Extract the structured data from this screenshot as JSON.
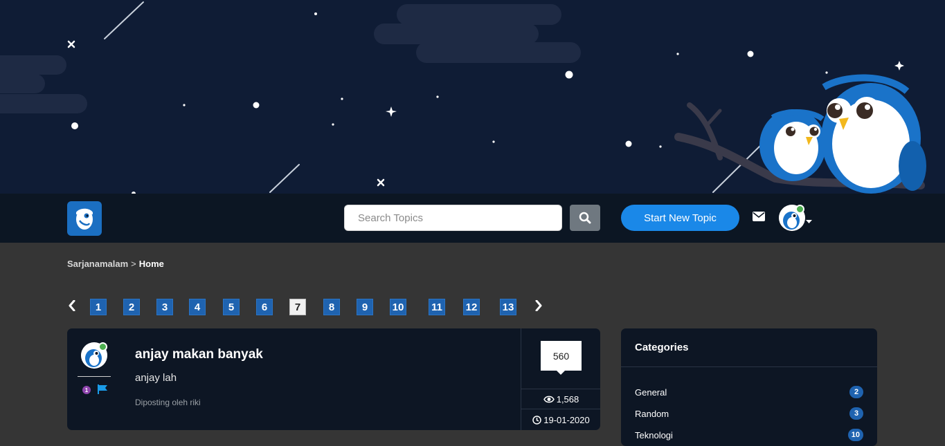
{
  "brand": {
    "logo": "owl-logo"
  },
  "search": {
    "placeholder": "Search Topics"
  },
  "nav": {
    "new_topic_label": "Start New Topic"
  },
  "breadcrumb": {
    "root": "Sarjanamalam",
    "separator": ">",
    "current": "Home"
  },
  "pagination": {
    "pages": [
      "1",
      "2",
      "3",
      "4",
      "5",
      "6",
      "7",
      "8",
      "9",
      "10",
      "11",
      "12",
      "13"
    ],
    "active": "7"
  },
  "topic": {
    "title": "anjay makan banyak",
    "excerpt": "anjay lah",
    "author_line": "Diposting oleh riki",
    "rank": "1",
    "replies": "560",
    "views": "1,568",
    "date": "19-01-2020"
  },
  "categories": {
    "title": "Categories",
    "items": [
      {
        "name": "General",
        "count": "2"
      },
      {
        "name": "Random",
        "count": "3"
      },
      {
        "name": "Teknologi",
        "count": "10"
      }
    ]
  },
  "colors": {
    "hero_bg": "#0f1c35",
    "navbar_bg": "#0c1623",
    "page_bg": "#353535",
    "accent": "#1a88e8",
    "page_btn": "#1f63b0"
  }
}
